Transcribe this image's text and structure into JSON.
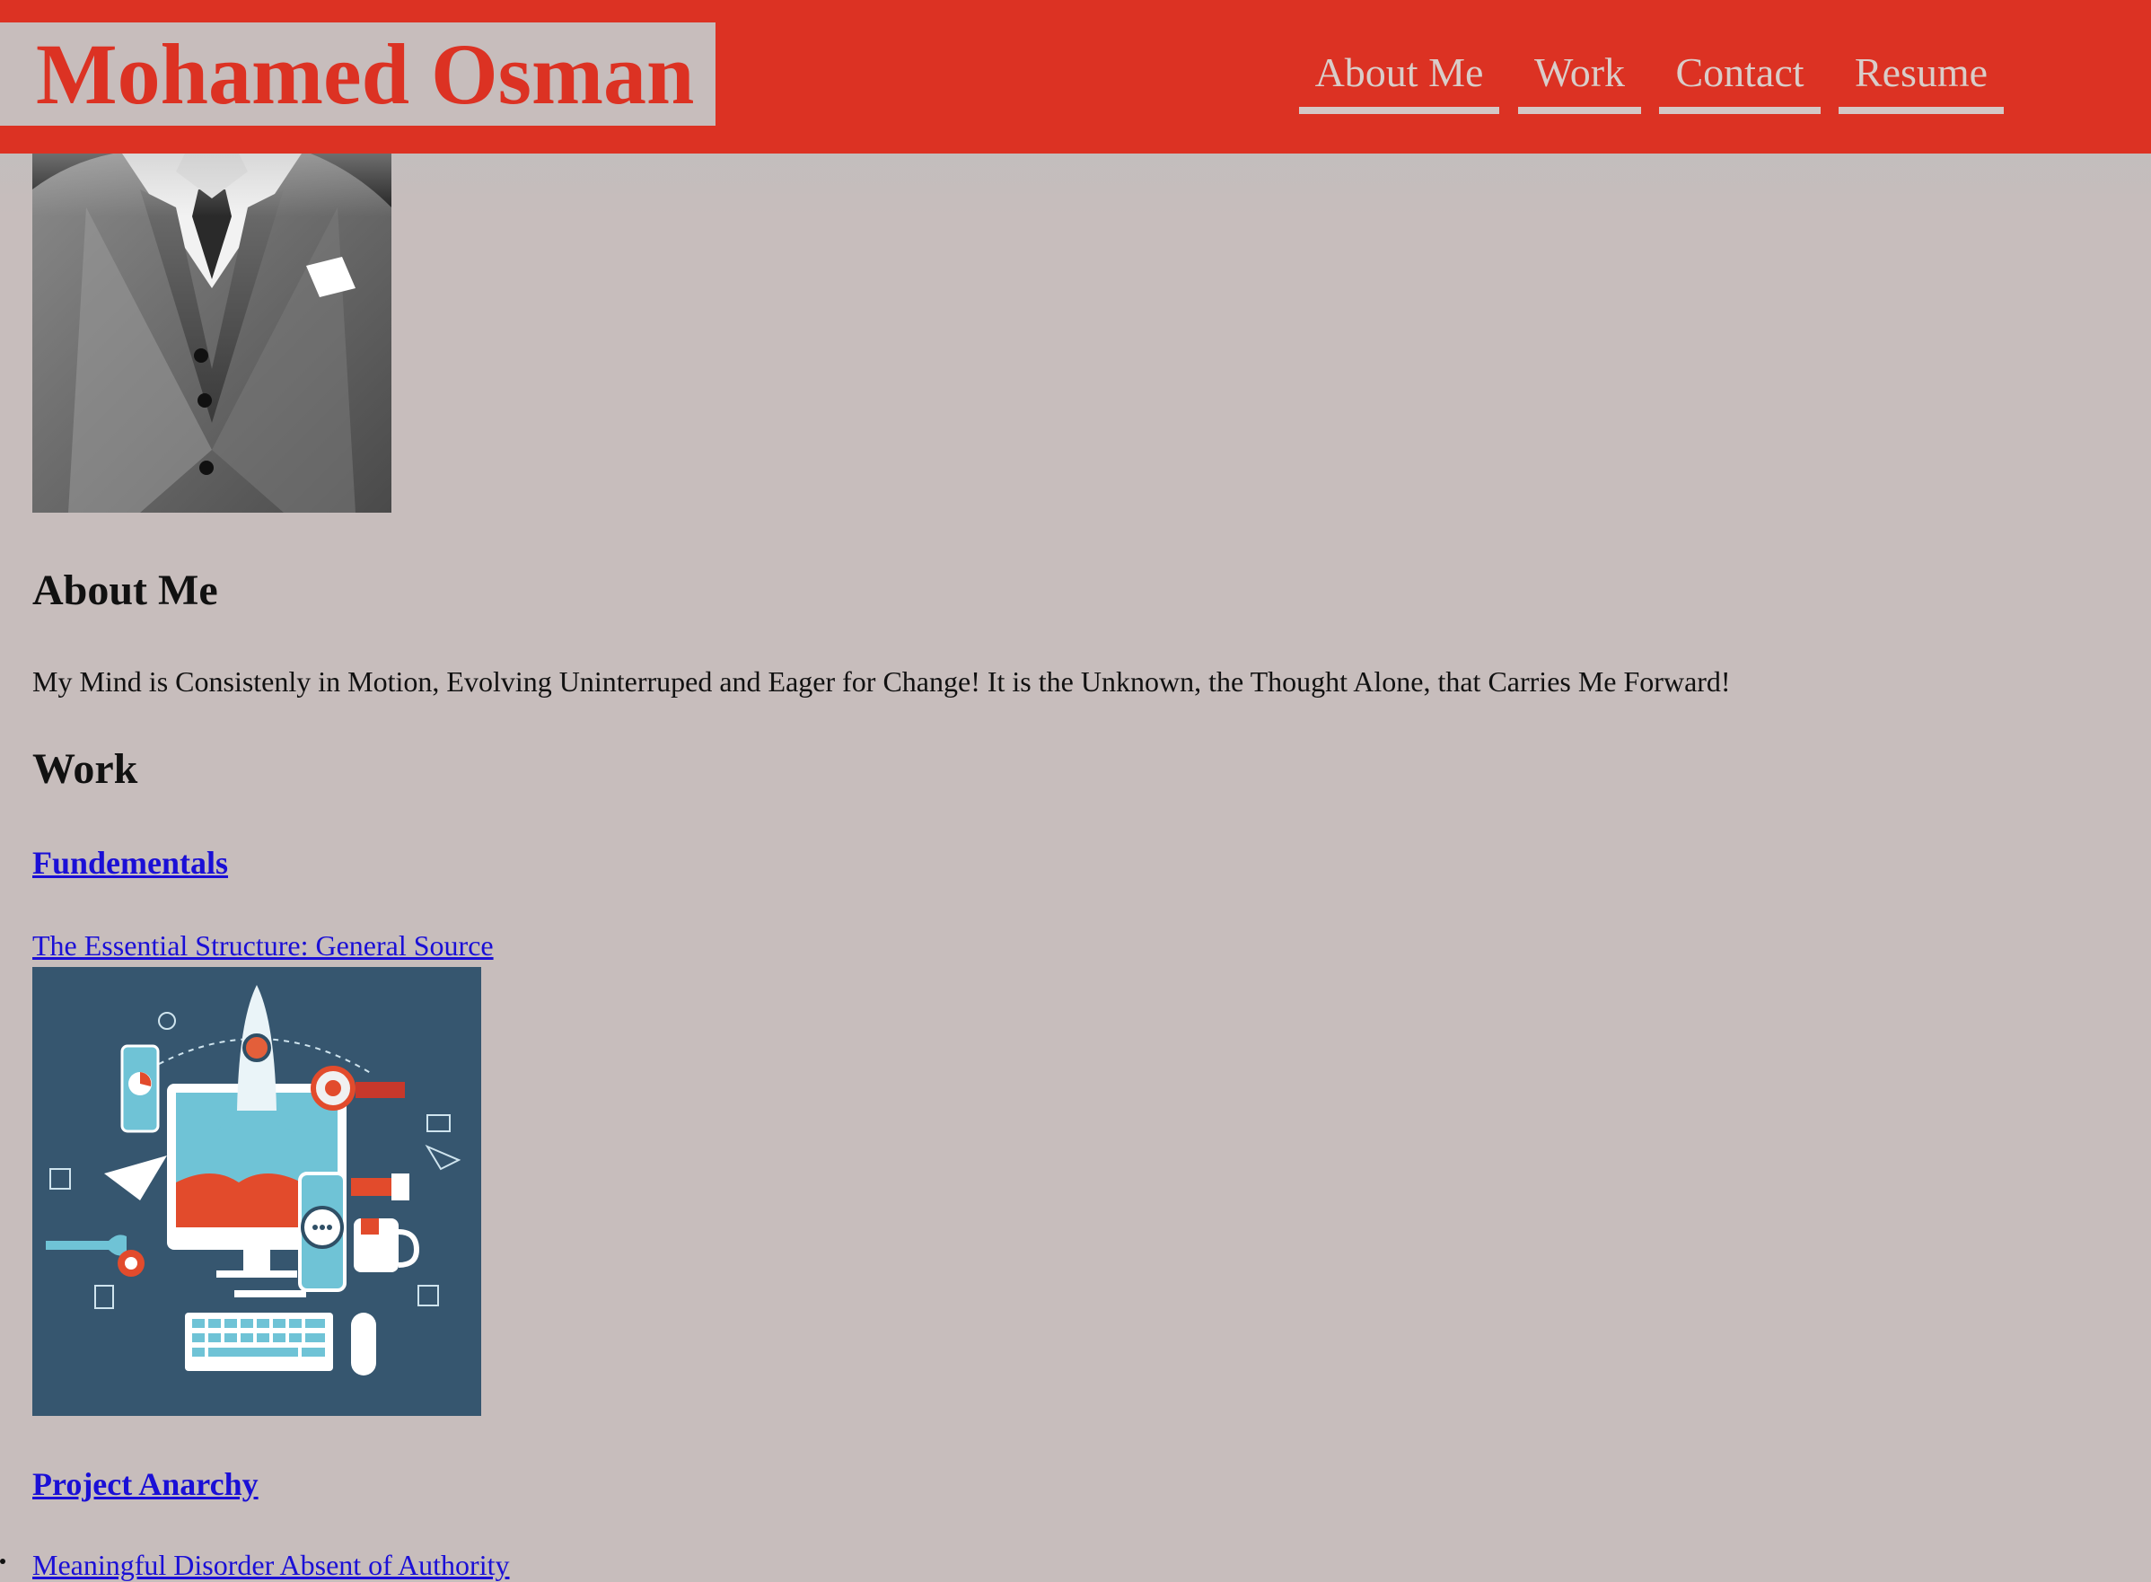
{
  "header": {
    "brand": "Mohamed Osman",
    "nav": [
      {
        "label": "About Me"
      },
      {
        "label": "Work"
      },
      {
        "label": "Contact"
      },
      {
        "label": "Resume"
      }
    ]
  },
  "about": {
    "heading": "About Me",
    "text": "My Mind is Consistenly in Motion, Evolving Uninterruped and Eager for Change! It is the Unknown, the Thought Alone, that Carries Me Forward!"
  },
  "work": {
    "heading": "Work",
    "projects": [
      {
        "title": "Fundementals",
        "link": "The Essential Structure: General Source"
      },
      {
        "title": "Project Anarchy",
        "link": "Meaningful Disorder Absent of Authority"
      }
    ]
  },
  "colors": {
    "header_bg": "#dc3223",
    "page_bg": "#c7bdbc",
    "link": "#1a0fd6",
    "illustration_bg": "#36566f"
  }
}
